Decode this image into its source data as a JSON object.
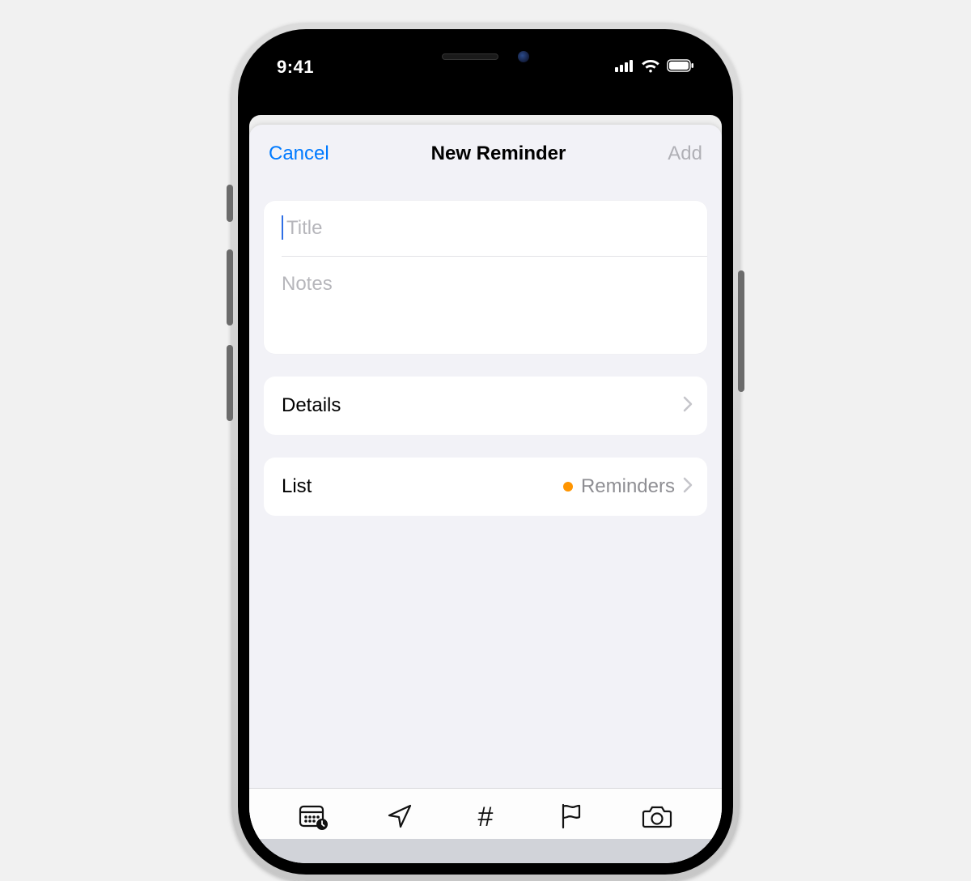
{
  "status": {
    "time": "9:41"
  },
  "nav": {
    "cancel": "Cancel",
    "title": "New Reminder",
    "add": "Add"
  },
  "fields": {
    "title_placeholder": "Title",
    "notes_placeholder": "Notes"
  },
  "rows": {
    "details_label": "Details",
    "list_label": "List",
    "list_value": "Reminders",
    "list_color": "#ff9500"
  },
  "toolbar": {
    "items": [
      "calendar",
      "location",
      "tag",
      "flag",
      "camera"
    ]
  }
}
